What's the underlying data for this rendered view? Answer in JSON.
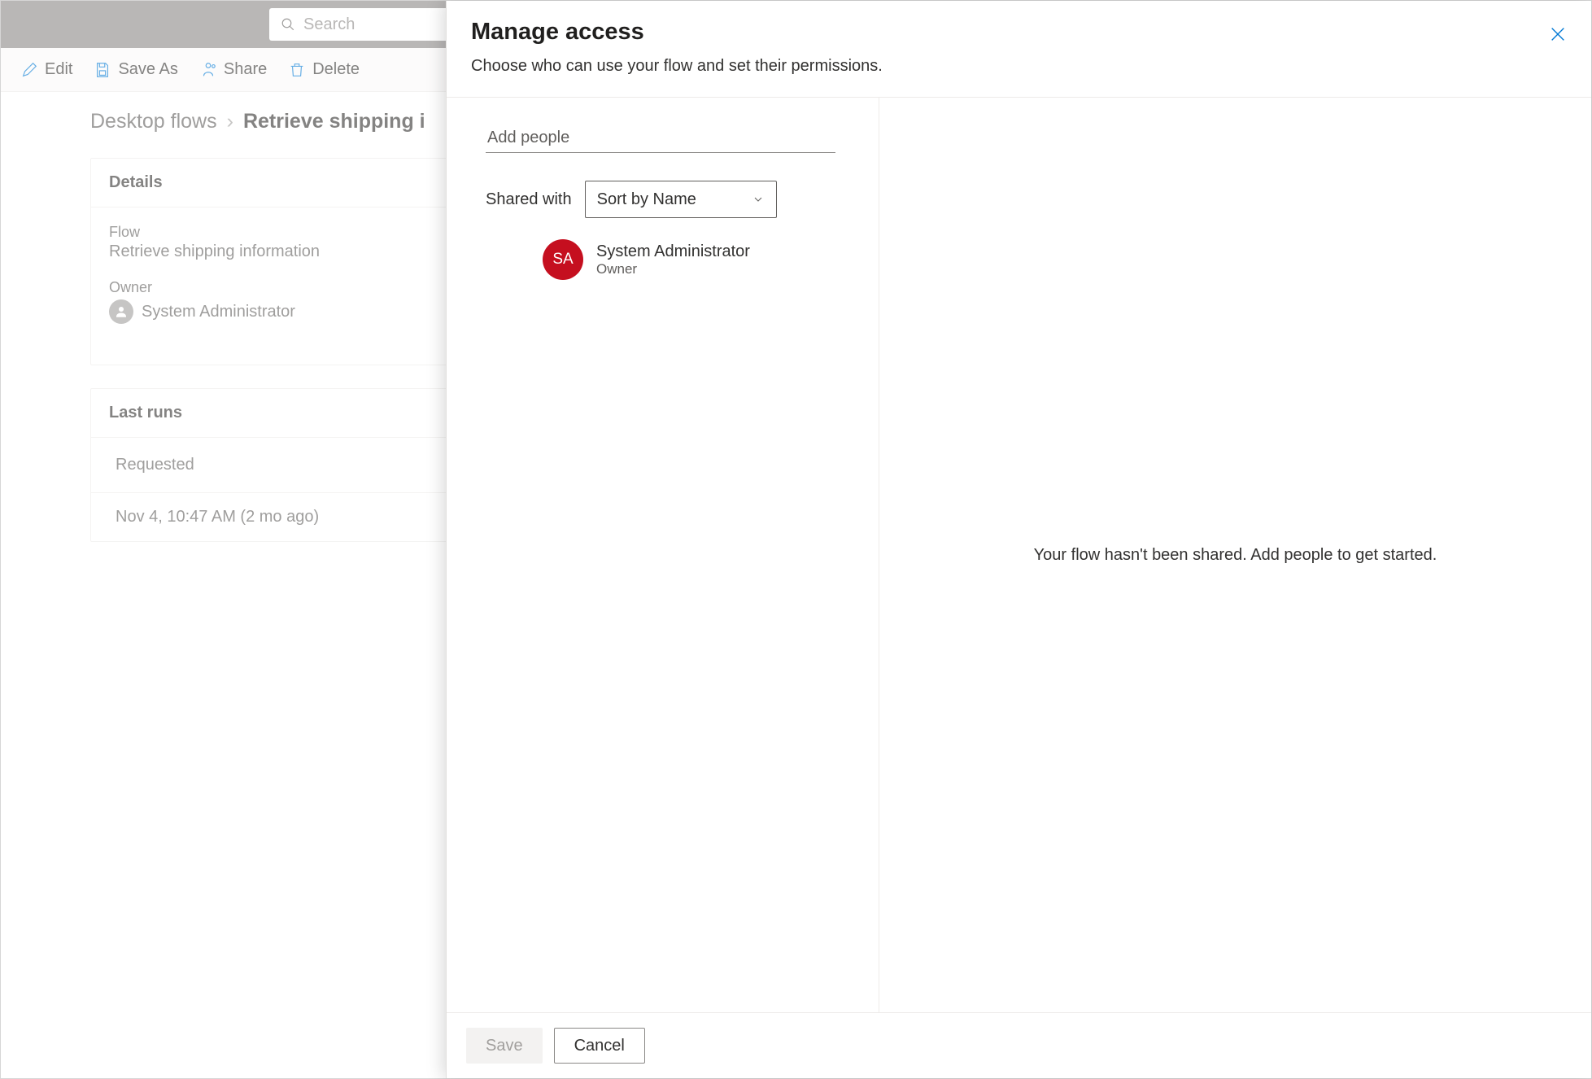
{
  "topbar": {
    "search_placeholder": "Search"
  },
  "commandbar": {
    "edit": "Edit",
    "save_as": "Save As",
    "share": "Share",
    "delete": "Delete"
  },
  "breadcrumb": {
    "root": "Desktop flows",
    "current": "Retrieve shipping i"
  },
  "details": {
    "header": "Details",
    "flow_label": "Flow",
    "flow_value": "Retrieve shipping information",
    "owner_label": "Owner",
    "owner_value": "System Administrator"
  },
  "last_runs": {
    "header": "Last runs",
    "column": "Requested",
    "row1": "Nov 4, 10:47 AM (2 mo ago)"
  },
  "panel": {
    "title": "Manage access",
    "subtitle": "Choose who can use your flow and set their permissions.",
    "add_placeholder": "Add people",
    "shared_with_label": "Shared with",
    "sort_value": "Sort by Name",
    "person": {
      "initials": "SA",
      "name": "System Administrator",
      "role": "Owner"
    },
    "empty_message": "Your flow hasn't been shared. Add people to get started.",
    "save": "Save",
    "cancel": "Cancel"
  }
}
